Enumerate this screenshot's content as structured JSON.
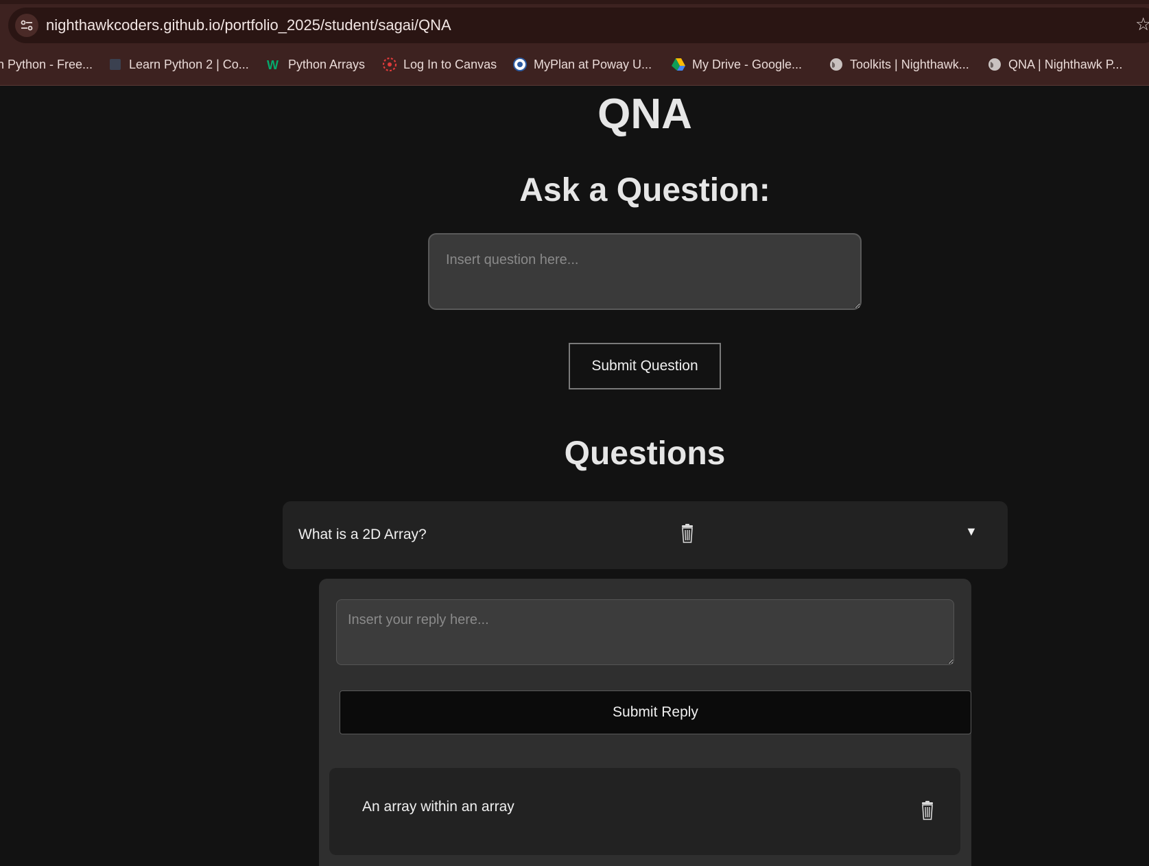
{
  "browser": {
    "url": "nighthawkcoders.github.io/portfolio_2025/student/sagai/QNA",
    "bookmarks": [
      {
        "label": "n Python - Free...",
        "icon": "page-icon"
      },
      {
        "label": "Learn Python 2 | Co...",
        "icon": "codecademy-icon"
      },
      {
        "label": "Python Arrays",
        "icon": "w3schools-icon"
      },
      {
        "label": "Log In to Canvas",
        "icon": "canvas-icon"
      },
      {
        "label": "MyPlan at Poway U...",
        "icon": "myplan-icon"
      },
      {
        "label": "My Drive - Google...",
        "icon": "google-drive-icon"
      },
      {
        "label": "Toolkits | Nighthawk...",
        "icon": "globe-icon"
      },
      {
        "label": "QNA | Nighthawk P...",
        "icon": "globe-icon"
      }
    ]
  },
  "page": {
    "title": "QNA",
    "ask_heading": "Ask a Question:",
    "question_placeholder": "Insert question here...",
    "submit_question_label": "Submit Question",
    "questions_heading": "Questions",
    "questions": [
      {
        "text": "What is a 2D Array?",
        "toggle_icon": "▼",
        "reply_placeholder": "Insert your reply here...",
        "submit_reply_label": "Submit Reply",
        "replies": [
          {
            "text": "An array within an array"
          }
        ]
      }
    ]
  },
  "colors": {
    "background": "#121212",
    "chrome": "#3d2220",
    "card": "#222222",
    "panel": "#2f2f2f"
  }
}
